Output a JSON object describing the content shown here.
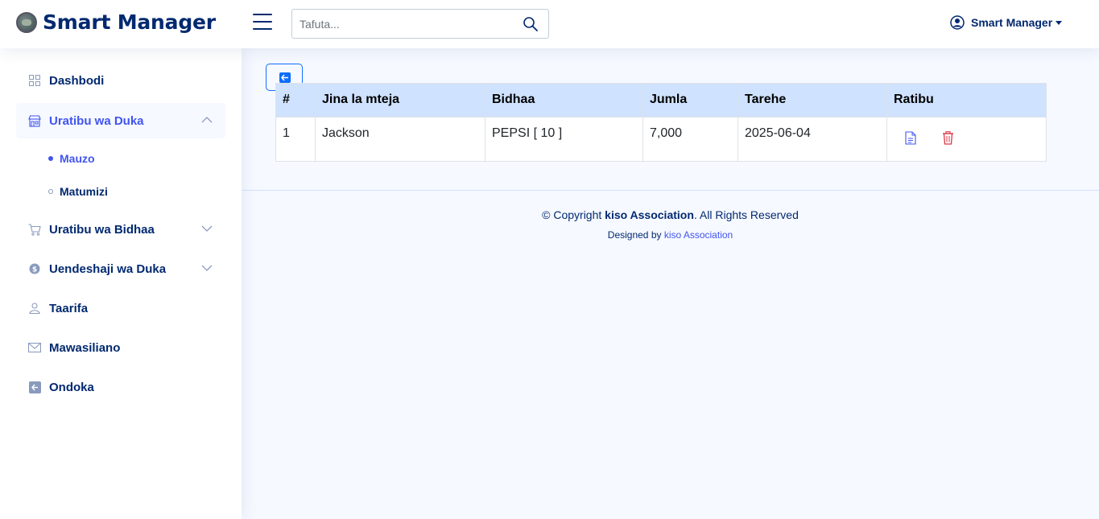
{
  "app": {
    "title": "Smart Manager"
  },
  "search": {
    "placeholder": "Tafuta..."
  },
  "profile": {
    "name": "Smart Manager"
  },
  "sidebar": {
    "items": [
      {
        "label": "Dashbodi",
        "icon": "grid-icon"
      },
      {
        "label": "Uratibu wa Duka",
        "icon": "shop-icon"
      },
      {
        "label": "Uratibu wa Bidhaa",
        "icon": "cart-icon"
      },
      {
        "label": "Uendeshaji wa Duka",
        "icon": "dollar-icon"
      },
      {
        "label": "Taarifa",
        "icon": "person-icon"
      },
      {
        "label": "Mawasiliano",
        "icon": "envelope-icon"
      },
      {
        "label": "Ondoka",
        "icon": "logout-icon"
      }
    ],
    "sub_items": [
      {
        "label": "Mauzo"
      },
      {
        "label": "Matumizi"
      }
    ]
  },
  "table": {
    "headers": [
      "#",
      "Jina la mteja",
      "Bidhaa",
      "Jumla",
      "Tarehe",
      "Ratibu"
    ],
    "rows": [
      {
        "num": "1",
        "customer": "Jackson",
        "product": "PEPSI [ 10 ]",
        "total": "7,000",
        "date": "2025-06-04"
      }
    ]
  },
  "footer": {
    "copyright_prefix": "© Copyright ",
    "org": "kiso Association",
    "copyright_suffix": ". All Rights Reserved",
    "designed_by": "Designed by ",
    "designer": "kiso Association"
  },
  "colors": {
    "primary": "#012970",
    "accent": "#4154f1",
    "danger": "#dc3545",
    "header_bg": "#cfe2ff"
  }
}
